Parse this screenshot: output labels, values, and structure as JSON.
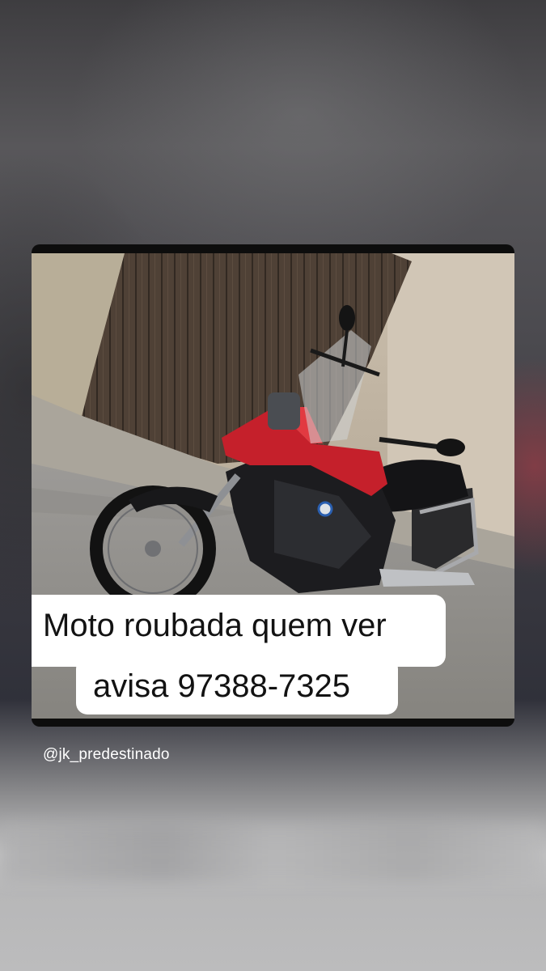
{
  "story": {
    "caption_line1": "Moto roubada quem ver",
    "caption_line2": "avisa 97388-7325",
    "mention": "@jk_predestinado"
  },
  "colors": {
    "caption_bg": "#ffffff",
    "caption_text": "#121212",
    "card_frame": "#0d0d0d",
    "mention_text": "#ffffff"
  }
}
